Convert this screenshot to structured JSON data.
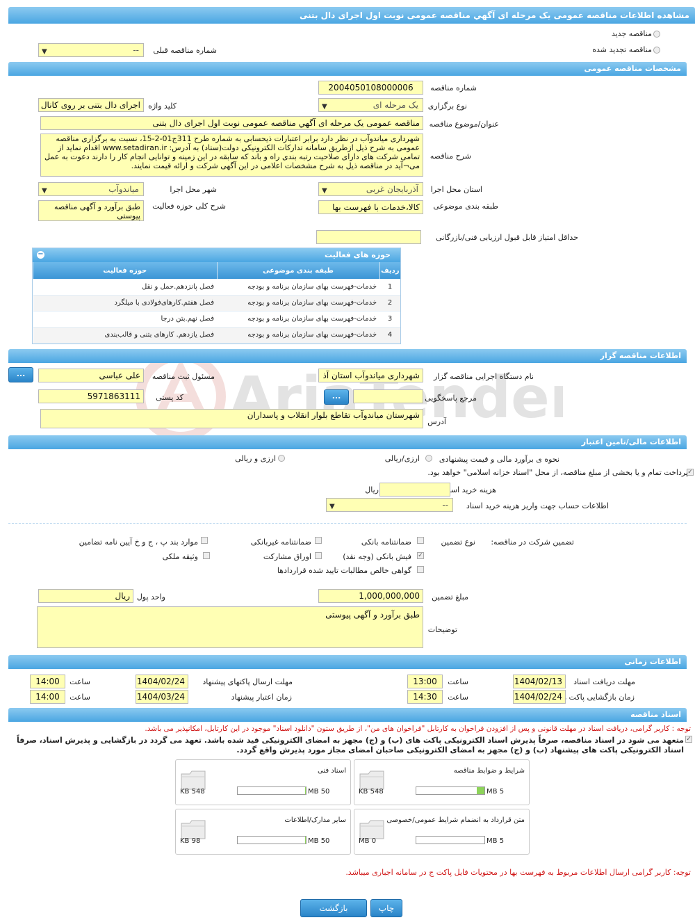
{
  "header": {
    "title": "مشاهده اطلاعات مناقصه عمومی یک مرحله ای آگهي مناقصه عمومی نوبت اول اجرای دال بتنی"
  },
  "type_options": {
    "new": "مناقصه جدید",
    "renewed": "مناقصه تجدید شده",
    "prev_number_label": "شماره مناقصه قبلی",
    "prev_number_value": "--"
  },
  "general": {
    "section_title": "مشخصات مناقصه عمومی",
    "number_label": "شماره مناقصه",
    "number_value": "2004050108000006",
    "hold_type_label": "نوع برگزاری",
    "hold_type_value": "یک مرحله ای",
    "keyword_label": "کلید واژه",
    "keyword_value": "اجرای دال بتنی بر روی کانال",
    "subject_label": "عنوان/موضوع مناقصه",
    "subject_value": "مناقصه عمومی یک مرحله ای آگهي مناقصه عمومی نوبت اول اجرای دال بتنی",
    "desc_label": "شرح مناقصه",
    "desc_value": "شهرداری میاندوآب در نظر دارد برابر اعتبارات ذیحسابی به شماره طرح 311ج01-2-15، نسبت به برگزاری مناقصه عمومی به شرح ذیل ازطریق سامانه تدارکات الکترونیکی دولت(ستاد) به آدرس: www.setadiran.ir اقدام نماید از تمامی شرکت های دارای صلاحیت رتبه بندی راه و باند که سابقه در این زمینه و توانایی انجام کار را دارند دعوت به عمل می¬آید در مناقصه ذیل به شرح مشخصات اعلامی در این آگهی شرکت و ارائه قیمت نمایند.",
    "province_label": "استان محل اجرا",
    "province_value": "آذربایجان غربی",
    "city_label": "شهر محل اجرا",
    "city_value": "میاندوآب",
    "category_label": "طبقه بندی موضوعی",
    "category_value": "کالا،خدمات با فهرست بها",
    "activity_desc_label": "شرح کلی حوزه فعالیت",
    "activity_desc_value": "طبق برآورد و آگهی مناقصه پیوستی",
    "min_score_label": "حداقل امتیاز قابل قبول ارزیابی فنی/بازرگانی",
    "min_score_value": ""
  },
  "activities": {
    "title": "حوزه های فعالیت",
    "toggle": "−",
    "headers": [
      "ردیف",
      "طبقه بندی موضوعی",
      "حوزه فعالیت"
    ],
    "rows": [
      [
        "1",
        "خدمات-فهرست بهای سازمان برنامه و بودجه",
        "فصل پانزدهم.حمل و نقل"
      ],
      [
        "2",
        "خدمات-فهرست بهای سازمان برنامه و بودجه",
        "فصل هفتم.کارهای‌فولادی با میلگرد"
      ],
      [
        "3",
        "خدمات-فهرست بهای سازمان برنامه و بودجه",
        "فصل نهم.بتن درجا"
      ],
      [
        "4",
        "خدمات-فهرست بهای سازمان برنامه و بودجه",
        "فصل یازدهم. کارهای بتنی و قالب‌بندی"
      ]
    ]
  },
  "organizer": {
    "section_title": "اطلاعات مناقصه گزار",
    "org_label": "نام دستگاه اجرایی مناقصه گزار",
    "org_value": "شهرداری میاندوآب استان آذ",
    "registrar_label": "مسئول ثبت مناقصه",
    "registrar_value": "علی عباسی",
    "ref_label": "مرجع پاسخگویی",
    "ref_value": "",
    "postal_label": "کد پستی",
    "postal_value": "5971863111",
    "address_label": "آدرس",
    "address_value": "شهرستان میاندوآب تقاطع بلوار انقلاب و پاسداران",
    "dots": "..."
  },
  "finance": {
    "section_title": "اطلاعات مالی/تامین اعتبار",
    "estimate_label": "نحوه ی برآورد مالی و قیمت پیشنهادی",
    "opt1": "ارزی/ریالی",
    "opt2": "ارزی و ریالی",
    "treasury_text": "پرداخت تمام و یا بخشی از مبلغ مناقصه، از محل \"اسناد خزانه اسلامی\" خواهد بود.",
    "doc_cost_label": "هزینه خرید اسناد",
    "doc_cost_value": "",
    "doc_cost_unit": "ریال",
    "account_label": "اطلاعات حساب جهت واریز هزینه خرید اسناد",
    "account_value": "--"
  },
  "guarantee": {
    "label": "تضمین شرکت در مناقصه:",
    "type_label": "نوع تضمین",
    "options": [
      "ضمانتنامه بانکی",
      "ضمانتنامه غیربانکی",
      "موارد بند پ ، ج و خ آیین نامه تضامین",
      "فیش بانکی (وجه نقد)",
      "اوراق مشارکت",
      "وثیقه ملکی",
      "گواهی خالص مطالبات تایید شده قراردادها"
    ],
    "amount_label": "مبلغ تضمین",
    "amount_value": "1,000,000,000",
    "currency_label": "واحد پول",
    "currency_value": "ریال",
    "notes_label": "توضیحات",
    "notes_value": "طبق برآورد و آگهی پیوستی"
  },
  "timing": {
    "section_title": "اطلاعات زمانی",
    "receive_label": "مهلت دریافت اسناد",
    "receive_date": "1404/02/13",
    "receive_time": "13:00",
    "send_label": "مهلت ارسال پاکتهای پیشنهاد",
    "send_date": "1404/02/24",
    "send_time": "14:00",
    "open_label": "زمان بازگشایی پاکت ها",
    "open_date": "1404/02/24",
    "open_time": "14:30",
    "valid_label": "زمان اعتبار پیشنهاد",
    "valid_date": "1404/03/24",
    "valid_time": "14:00",
    "time_label": "ساعت"
  },
  "docs": {
    "section_title": "اسناد مناقصه",
    "note1": "توجه : کاربر گرامی، دریافت اسناد در مهلت قانونی و پس از افزودن فراخوان به کارتابل \"فراخوان های من\"، از طریق ستون \"دانلود اسناد\" موجود در این کارتابل، امکانپذیر می باشد.",
    "note2": "متعهد می شود در اسناد مناقصه، صرفاً پذیرش اسناد الکترونیکی پاکت های (ب) و (ج) مجهز به امضای الکترونیکی قید شده باشد. تعهد می گردد در بازگشایی و پذیرش اسناد، صرفاً اسناد الکترونیکی پاکت های پیشنهاد (ب) و (ج) مجهز به امضای الکترونیکی صاحبان امضای مجاز مورد پذیرش واقع گردد.",
    "files": [
      {
        "title": "شرایط و ضوابط مناقصه",
        "max": "5 MB",
        "size": "548 KB",
        "fill": 0.11
      },
      {
        "title": "اسناد فنی",
        "max": "50 MB",
        "size": "548 KB",
        "fill": 0.011
      },
      {
        "title": "متن قرارداد به انضمام شرایط عمومی/خصوصی",
        "max": "5 MB",
        "size": "0 MB",
        "fill": 0
      },
      {
        "title": "سایر مدارک/اطلاعات",
        "max": "50 MB",
        "size": "98 KB",
        "fill": 0.002
      }
    ],
    "note3": "توجه: کاربر گرامی ارسال اطلاعات مربوط به فهرست بها در محتویات فایل پاکت ج در سامانه اجباری میباشد."
  },
  "actions": {
    "print": "چاپ",
    "back": "بازگشت"
  },
  "watermark": "AriaTender.neT",
  "colors": {
    "accent": "#4aa6e2",
    "field": "#ffffb4",
    "alert": "#d01818"
  }
}
